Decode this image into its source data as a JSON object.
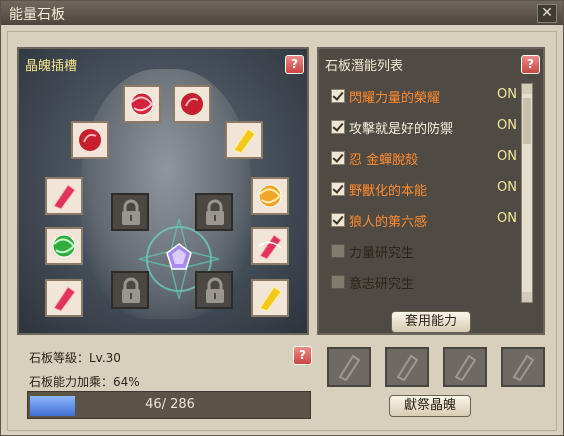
{
  "window": {
    "title": "能量石板",
    "close_glyph": "✕"
  },
  "slot_panel": {
    "title": "晶魄插槽",
    "help_glyph": "?"
  },
  "potential_panel": {
    "title": "石板潛能列表",
    "help_glyph": "?",
    "items": [
      {
        "label": "閃耀力量的榮耀",
        "status": "ON",
        "checked": true,
        "color": "#ff8c2e"
      },
      {
        "label": "攻擊就是好的防禦",
        "status": "ON",
        "checked": true,
        "color": "#f6f0de"
      },
      {
        "label": "忍 金蟬脫殼",
        "status": "ON",
        "checked": true,
        "color": "#ff8c2e"
      },
      {
        "label": "野獸化的本能",
        "status": "ON",
        "checked": true,
        "color": "#ff8c2e"
      },
      {
        "label": "狼人的第六感",
        "status": "ON",
        "checked": true,
        "color": "#ff8c2e"
      },
      {
        "label": "力量研究生",
        "status": "",
        "checked": false,
        "color": "#2a2419"
      },
      {
        "label": "意志研究生",
        "status": "",
        "checked": false,
        "color": "#2a2419"
      }
    ],
    "apply_button": "套用能力"
  },
  "stats": {
    "level_label": "石板等級：Lv.30",
    "bonus_label": "石板能力加乘：64%",
    "help_glyph": "?",
    "progress_text": "46/ 286",
    "progress_current": 46,
    "progress_max": 286
  },
  "offer_button": "獻祭晶魄",
  "colors": {
    "accent": "#ff8c2e",
    "title": "#f2e48e",
    "progress": "#3f6fd0"
  },
  "slots": [
    {
      "icon": "red-swirl-orb-icon",
      "state": "filled"
    },
    {
      "icon": "red-orb-icon",
      "state": "filled"
    },
    {
      "icon": "red-orb-icon",
      "state": "filled"
    },
    {
      "icon": "yellow-crystal-icon",
      "state": "filled"
    },
    {
      "icon": "red-crystal-icon",
      "state": "filled"
    },
    {
      "icon": "orange-swirl-orb-icon",
      "state": "filled"
    },
    {
      "icon": "green-swirl-orb-icon",
      "state": "filled"
    },
    {
      "icon": "red-swirl-crystal-icon",
      "state": "filled"
    },
    {
      "icon": "red-crystal-icon",
      "state": "filled"
    },
    {
      "icon": "yellow-crystal-icon",
      "state": "filled"
    },
    {
      "icon": "lock-icon",
      "state": "locked"
    },
    {
      "icon": "lock-icon",
      "state": "locked"
    },
    {
      "icon": "lock-icon",
      "state": "locked"
    },
    {
      "icon": "lock-icon",
      "state": "locked"
    }
  ],
  "offering_slots": [
    "empty-crystal-slot-icon",
    "empty-crystal-slot-icon",
    "empty-crystal-slot-icon",
    "empty-crystal-slot-icon"
  ]
}
